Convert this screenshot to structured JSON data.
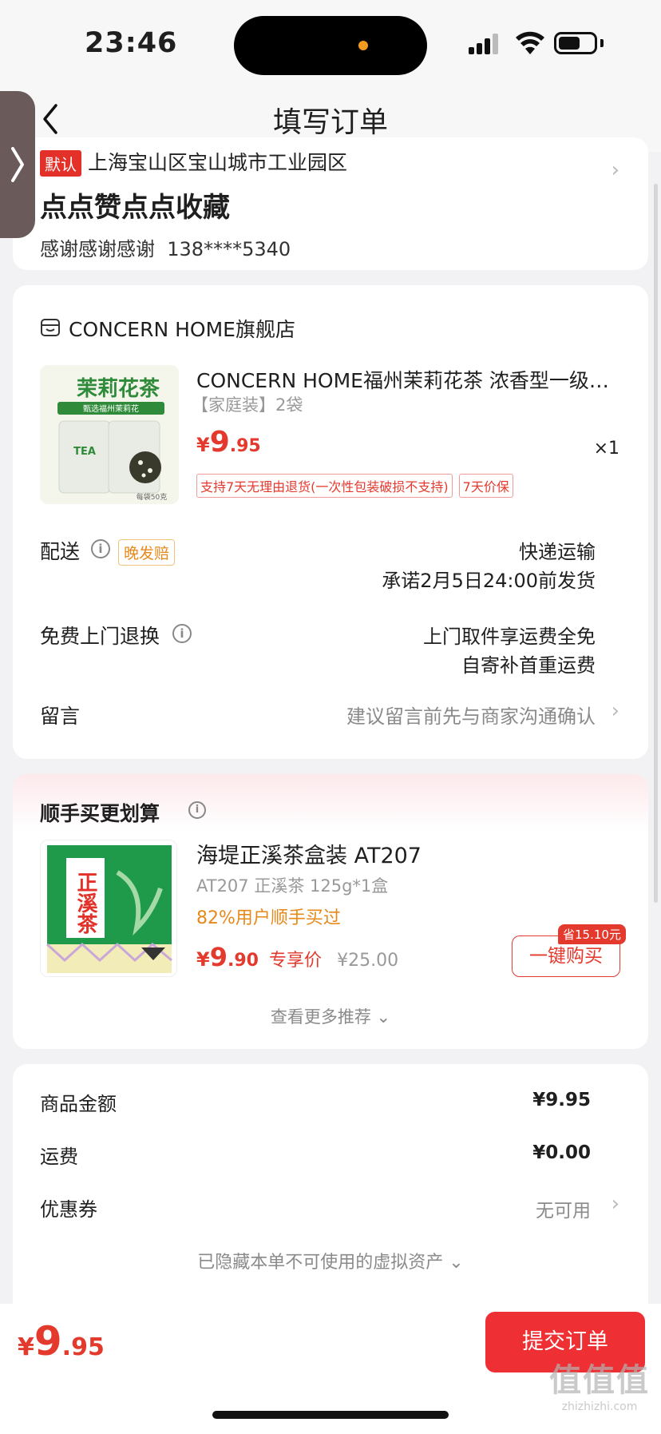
{
  "status_bar": {
    "time": "23:46"
  },
  "nav": {
    "title": "填写订单"
  },
  "address": {
    "default_tag": "默认",
    "line": "上海宝山区宝山城市工业园区",
    "name": "点点赞点点收藏",
    "contact_name": "感谢感谢感谢",
    "phone": "138****5340"
  },
  "shop": {
    "name": "CONCERN HOME旗舰店"
  },
  "product": {
    "image_text": "茉莉花茶",
    "image_subtitle": "甄选福州茉莉花",
    "image_label": "TEA",
    "image_net": "每袋50克",
    "title": "CONCERN HOME福州茉莉花茶 浓香型一级…",
    "sku": "【家庭装】2袋",
    "price_symbol": "¥",
    "price_int": "9",
    "price_dec": ".95",
    "qty": "×1",
    "tags": [
      "支持7天无理由退货(一次性包装破损不支持)",
      "7天价保"
    ]
  },
  "delivery": {
    "label": "配送",
    "badge": "晚发赔",
    "method": "快递运输",
    "promise": "承诺2月5日24:00前发货"
  },
  "returns": {
    "label": "免费上门退换",
    "line1": "上门取件享运费全免",
    "line2": "自寄补首重运费"
  },
  "message": {
    "label": "留言",
    "placeholder": "建议留言前先与商家沟通确认"
  },
  "recommend": {
    "title": "顺手买更划算",
    "image_text": "正溪茶",
    "name": "海堤正溪茶盒装 AT207",
    "spec": "AT207 正溪茶 125g*1盒",
    "bought": "82%用户顺手买过",
    "price_symbol": "¥",
    "price_int": "9",
    "price_dec": ".90",
    "exclusive": "专享价",
    "original": "¥25.00",
    "save_badge": "省15.10元",
    "buy_label": "一键购买",
    "more": "查看更多推荐"
  },
  "summary": {
    "goods_label": "商品金额",
    "goods_value": "¥9.95",
    "shipping_label": "运费",
    "shipping_value": "¥0.00",
    "coupon_label": "优惠券",
    "coupon_value": "无可用",
    "hidden_assets": "已隐藏本单不可使用的虚拟资产"
  },
  "bottom": {
    "price_symbol": "¥",
    "price_int": "9",
    "price_dec": ".95",
    "submit_label": "提交订单"
  },
  "watermark": {
    "big": "值值值",
    "small": "zhizhizhi.com"
  },
  "colors": {
    "accent_red": "#ee2f33",
    "price_red": "#e43a2e",
    "orange": "#e7891a"
  },
  "icons": [
    "back-arrow-icon",
    "side-chevron-icon",
    "shop-icon",
    "info-icon",
    "chevron-right-icon",
    "chevron-down-icon"
  ]
}
